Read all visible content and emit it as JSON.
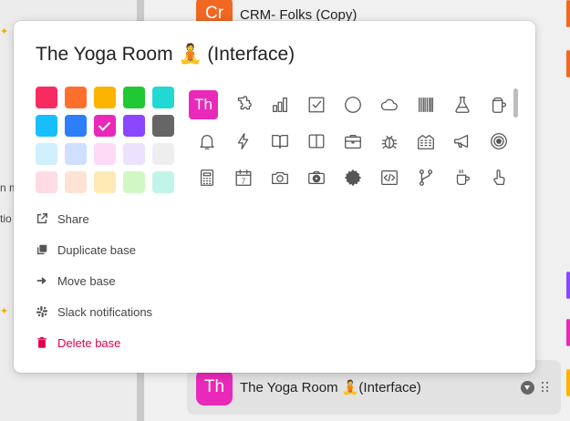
{
  "background": {
    "left_fragments": [
      "n m",
      "tio"
    ],
    "bases": [
      {
        "initials": "Cr",
        "name": "CRM- Folks (Copy)",
        "color": "#f26722"
      },
      {
        "initials": "Th",
        "name": "The Yoga Room 🧘(Interface)",
        "color": "#e929ba"
      }
    ],
    "right_accents": [
      "#f26722",
      "#f26722",
      "#8b46ff",
      "#e929ba",
      "#fcb400"
    ]
  },
  "popover": {
    "title": "The Yoga Room 🧘 (Interface)",
    "selected_color": "#e929ba",
    "colors": [
      "#f82b60",
      "#ff6f2c",
      "#fcb400",
      "#20c933",
      "#20d9d2",
      "#18bfff",
      "#2d7ff9",
      "#e929ba",
      "#8b46ff",
      "#666666",
      "#d0f0fd",
      "#cfdfff",
      "#ffdaf6",
      "#ede2fe",
      "#eeeeee",
      "#ffdce5",
      "#fee2d5",
      "#ffeab6",
      "#d1f7c4",
      "#c2f5e9"
    ],
    "icon_tile": {
      "initials": "Th"
    },
    "icons": [
      "initials-tile",
      "puzzle-icon",
      "bar-chart-icon",
      "checkbox-icon",
      "circle-icon",
      "cloud-icon",
      "barcode-icon",
      "flask-icon",
      "mug-icon",
      "bell-icon",
      "bolt-icon",
      "open-book-icon",
      "book-icon",
      "briefcase-icon",
      "bug-icon",
      "buildings-icon",
      "megaphone-icon",
      "target-icon",
      "calculator-icon",
      "calendar-icon",
      "camera-icon",
      "camera-alt-icon",
      "gear-icon",
      "code-icon",
      "branch-icon",
      "coffee-icon",
      "hand-pointer-icon"
    ],
    "calendar_day": "7",
    "menu": [
      {
        "label": "Share",
        "icon": "share-icon",
        "danger": false
      },
      {
        "label": "Duplicate base",
        "icon": "duplicate-icon",
        "danger": false
      },
      {
        "label": "Move base",
        "icon": "arrow-right-icon",
        "danger": false
      },
      {
        "label": "Slack notifications",
        "icon": "slack-icon",
        "danger": false
      },
      {
        "label": "Delete base",
        "icon": "trash-icon",
        "danger": true
      }
    ]
  }
}
